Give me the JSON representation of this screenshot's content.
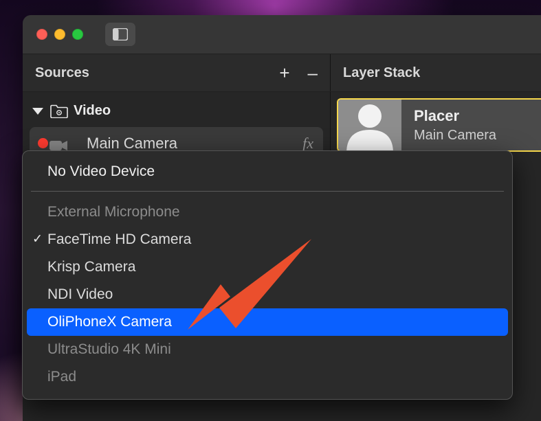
{
  "window": {
    "sidebar_toggle": "sidebar"
  },
  "panels": {
    "sources": {
      "title": "Sources",
      "add": "+",
      "remove": "–"
    },
    "layer_stack": {
      "title": "Layer Stack"
    }
  },
  "sources": {
    "group": "Video",
    "items": [
      {
        "label": "Main Camera",
        "fx": "fx",
        "live": true
      }
    ]
  },
  "layer": {
    "title": "Placer",
    "subtitle": "Main Camera"
  },
  "device_menu": {
    "header": "No Video Device",
    "options": [
      {
        "label": "External Microphone",
        "disabled": true,
        "checked": false,
        "highlighted": false
      },
      {
        "label": "FaceTime HD Camera",
        "disabled": false,
        "checked": true,
        "highlighted": false
      },
      {
        "label": "Krisp Camera",
        "disabled": false,
        "checked": false,
        "highlighted": false
      },
      {
        "label": "NDI Video",
        "disabled": false,
        "checked": false,
        "highlighted": false
      },
      {
        "label": "OliPhoneX Camera",
        "disabled": false,
        "checked": false,
        "highlighted": true
      },
      {
        "label": "UltraStudio 4K Mini",
        "disabled": true,
        "checked": false,
        "highlighted": false
      },
      {
        "label": "iPad",
        "disabled": true,
        "checked": false,
        "highlighted": false
      }
    ]
  },
  "colors": {
    "highlight": "#0a60ff",
    "selection_ring": "#f7d84c",
    "arrow": "#eb4f2d"
  }
}
